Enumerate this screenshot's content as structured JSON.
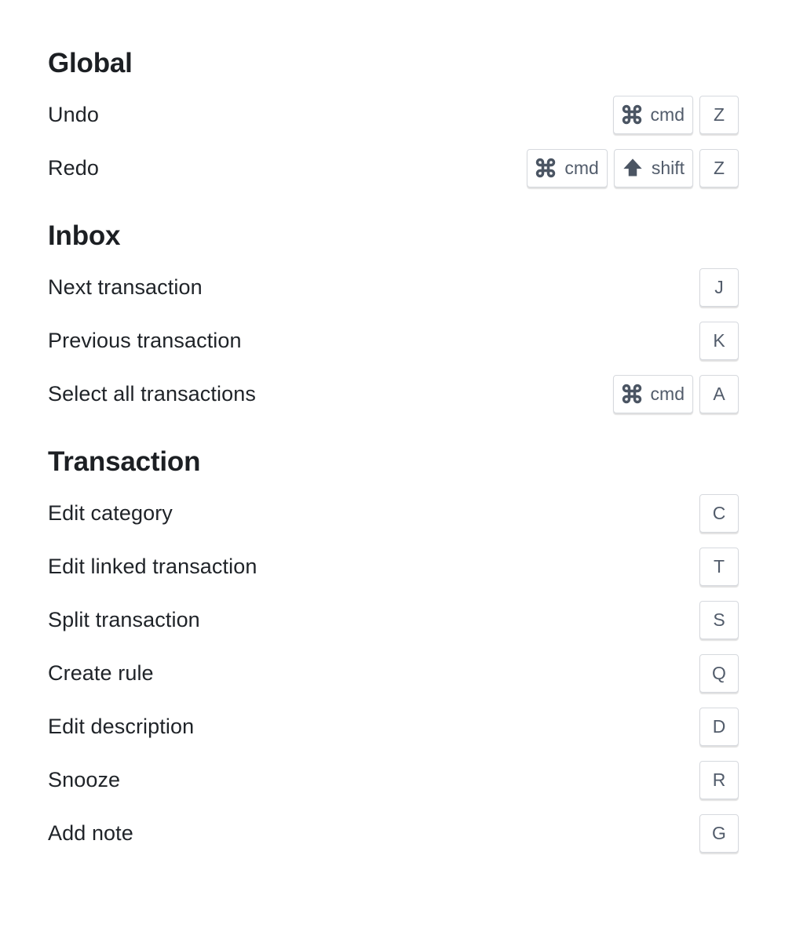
{
  "sections": [
    {
      "title": "Global",
      "rows": [
        {
          "label": "Undo",
          "keys": [
            {
              "icon": "command-icon",
              "label": "cmd"
            },
            {
              "label": "Z"
            }
          ]
        },
        {
          "label": "Redo",
          "keys": [
            {
              "icon": "command-icon",
              "label": "cmd"
            },
            {
              "icon": "shift-arrow-icon",
              "label": "shift"
            },
            {
              "label": "Z"
            }
          ]
        }
      ]
    },
    {
      "title": "Inbox",
      "rows": [
        {
          "label": "Next transaction",
          "keys": [
            {
              "label": "J"
            }
          ]
        },
        {
          "label": "Previous transaction",
          "keys": [
            {
              "label": "K"
            }
          ]
        },
        {
          "label": "Select all transactions",
          "keys": [
            {
              "icon": "command-icon",
              "label": "cmd"
            },
            {
              "label": "A"
            }
          ]
        }
      ]
    },
    {
      "title": "Transaction",
      "rows": [
        {
          "label": "Edit category",
          "keys": [
            {
              "label": "C"
            }
          ]
        },
        {
          "label": "Edit linked transaction",
          "keys": [
            {
              "label": "T"
            }
          ]
        },
        {
          "label": "Split transaction",
          "keys": [
            {
              "label": "S"
            }
          ]
        },
        {
          "label": "Create rule",
          "keys": [
            {
              "label": "Q"
            }
          ]
        },
        {
          "label": "Edit description",
          "keys": [
            {
              "label": "D"
            }
          ]
        },
        {
          "label": "Snooze",
          "keys": [
            {
              "label": "R"
            }
          ]
        },
        {
          "label": "Add note",
          "keys": [
            {
              "label": "G"
            }
          ]
        }
      ]
    }
  ],
  "colors": {
    "heading": "#1c1f23",
    "text": "#1f2328",
    "key_text": "#525c6b",
    "key_border": "#d6d9de"
  }
}
